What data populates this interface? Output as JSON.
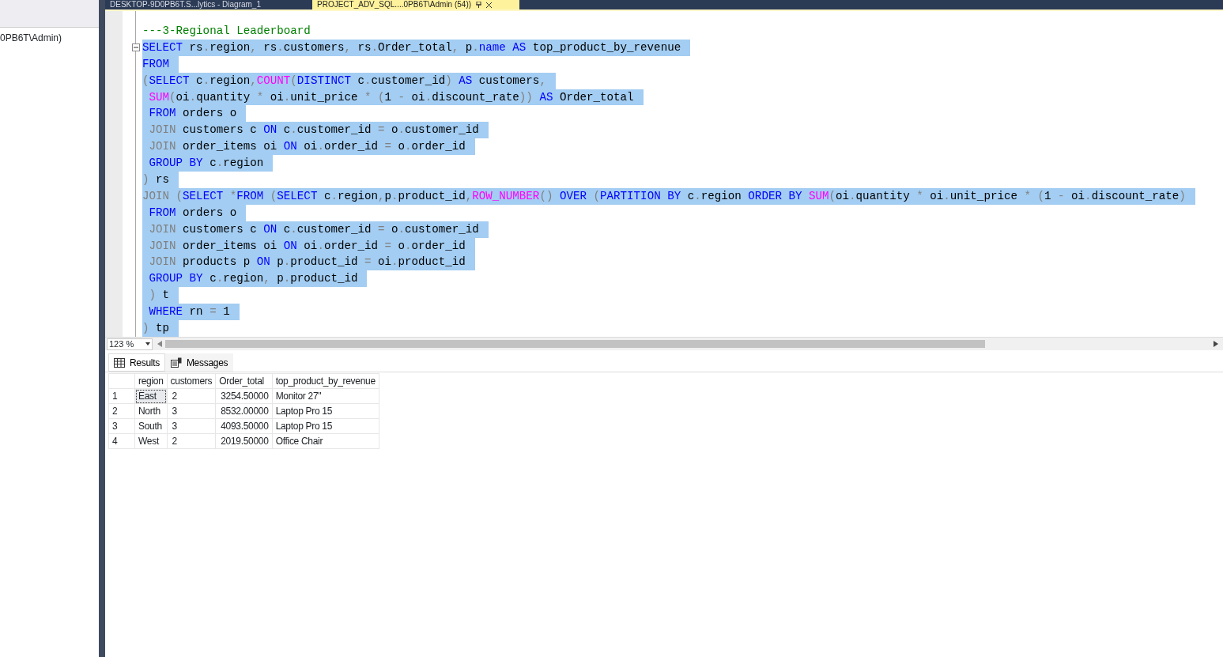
{
  "explorer": {
    "connection_text": "0PB6T\\Admin)"
  },
  "document_tabs": [
    {
      "label": "DESKTOP-9D0PB6T.S...lytics - Diagram_1",
      "selected": false
    },
    {
      "label": "PROJECT_ADV_SQL....0PB6T\\Admin (54))",
      "selected": true
    }
  ],
  "editor": {
    "lines": [
      {
        "selected": false,
        "fold": false,
        "tokens": [
          {
            "kind": "comment",
            "text": "---3-Regional Leaderboard"
          }
        ]
      },
      {
        "selected": true,
        "fold": true,
        "tokens": [
          {
            "kind": "keyword",
            "text": "SELECT"
          },
          {
            "kind": "plain",
            "text": " rs"
          },
          {
            "kind": "operator",
            "text": "."
          },
          {
            "kind": "plain",
            "text": "region"
          },
          {
            "kind": "operator",
            "text": ","
          },
          {
            "kind": "plain",
            "text": " rs"
          },
          {
            "kind": "operator",
            "text": "."
          },
          {
            "kind": "plain",
            "text": "customers"
          },
          {
            "kind": "operator",
            "text": ","
          },
          {
            "kind": "plain",
            "text": " rs"
          },
          {
            "kind": "operator",
            "text": "."
          },
          {
            "kind": "plain",
            "text": "Order_total"
          },
          {
            "kind": "operator",
            "text": ","
          },
          {
            "kind": "plain",
            "text": " p"
          },
          {
            "kind": "operator",
            "text": "."
          },
          {
            "kind": "keyword",
            "text": "name AS"
          },
          {
            "kind": "plain",
            "text": " top_product_by_revenue"
          }
        ]
      },
      {
        "selected": true,
        "fold": false,
        "tokens": [
          {
            "kind": "keyword",
            "text": "FROM"
          }
        ]
      },
      {
        "selected": true,
        "fold": false,
        "tokens": [
          {
            "kind": "operator",
            "text": "("
          },
          {
            "kind": "keyword",
            "text": "SELECT"
          },
          {
            "kind": "plain",
            "text": " c"
          },
          {
            "kind": "operator",
            "text": "."
          },
          {
            "kind": "plain",
            "text": "region"
          },
          {
            "kind": "operator",
            "text": ","
          },
          {
            "kind": "function",
            "text": "COUNT"
          },
          {
            "kind": "operator",
            "text": "("
          },
          {
            "kind": "keyword",
            "text": "DISTINCT"
          },
          {
            "kind": "plain",
            "text": " c"
          },
          {
            "kind": "operator",
            "text": "."
          },
          {
            "kind": "plain",
            "text": "customer_id"
          },
          {
            "kind": "operator",
            "text": ") "
          },
          {
            "kind": "keyword",
            "text": "AS"
          },
          {
            "kind": "plain",
            "text": " customers"
          },
          {
            "kind": "operator",
            "text": ","
          }
        ]
      },
      {
        "selected": true,
        "fold": false,
        "tokens": [
          {
            "kind": "function",
            "text": " SUM"
          },
          {
            "kind": "operator",
            "text": "("
          },
          {
            "kind": "plain",
            "text": "oi"
          },
          {
            "kind": "operator",
            "text": "."
          },
          {
            "kind": "plain",
            "text": "quantity "
          },
          {
            "kind": "operator",
            "text": "*"
          },
          {
            "kind": "plain",
            "text": " oi"
          },
          {
            "kind": "operator",
            "text": "."
          },
          {
            "kind": "plain",
            "text": "unit_price "
          },
          {
            "kind": "operator",
            "text": "* ("
          },
          {
            "kind": "plain",
            "text": "1 "
          },
          {
            "kind": "operator",
            "text": "-"
          },
          {
            "kind": "plain",
            "text": " oi"
          },
          {
            "kind": "operator",
            "text": "."
          },
          {
            "kind": "plain",
            "text": "discount_rate"
          },
          {
            "kind": "operator",
            "text": ")) "
          },
          {
            "kind": "keyword",
            "text": "AS"
          },
          {
            "kind": "plain",
            "text": " Order_total"
          }
        ]
      },
      {
        "selected": true,
        "fold": false,
        "tokens": [
          {
            "kind": "keyword",
            "text": " FROM"
          },
          {
            "kind": "plain",
            "text": " orders o"
          }
        ]
      },
      {
        "selected": true,
        "fold": false,
        "tokens": [
          {
            "kind": "operator",
            "text": " JOIN"
          },
          {
            "kind": "plain",
            "text": " customers c "
          },
          {
            "kind": "keyword",
            "text": "ON"
          },
          {
            "kind": "plain",
            "text": " c"
          },
          {
            "kind": "operator",
            "text": "."
          },
          {
            "kind": "plain",
            "text": "customer_id "
          },
          {
            "kind": "operator",
            "text": "="
          },
          {
            "kind": "plain",
            "text": " o"
          },
          {
            "kind": "operator",
            "text": "."
          },
          {
            "kind": "plain",
            "text": "customer_id"
          }
        ]
      },
      {
        "selected": true,
        "fold": false,
        "tokens": [
          {
            "kind": "operator",
            "text": " JOIN"
          },
          {
            "kind": "plain",
            "text": " order_items oi "
          },
          {
            "kind": "keyword",
            "text": "ON"
          },
          {
            "kind": "plain",
            "text": " oi"
          },
          {
            "kind": "operator",
            "text": "."
          },
          {
            "kind": "plain",
            "text": "order_id "
          },
          {
            "kind": "operator",
            "text": "="
          },
          {
            "kind": "plain",
            "text": " o"
          },
          {
            "kind": "operator",
            "text": "."
          },
          {
            "kind": "plain",
            "text": "order_id"
          }
        ]
      },
      {
        "selected": true,
        "fold": false,
        "tokens": [
          {
            "kind": "keyword",
            "text": " GROUP BY"
          },
          {
            "kind": "plain",
            "text": " c"
          },
          {
            "kind": "operator",
            "text": "."
          },
          {
            "kind": "plain",
            "text": "region"
          }
        ]
      },
      {
        "selected": true,
        "fold": false,
        "tokens": [
          {
            "kind": "operator",
            "text": ")"
          },
          {
            "kind": "plain",
            "text": " rs"
          }
        ]
      },
      {
        "selected": true,
        "fold": false,
        "tokens": [
          {
            "kind": "operator",
            "text": "JOIN ("
          },
          {
            "kind": "keyword",
            "text": "SELECT"
          },
          {
            "kind": "operator",
            "text": " *"
          },
          {
            "kind": "keyword",
            "text": "FROM"
          },
          {
            "kind": "operator",
            "text": " ("
          },
          {
            "kind": "keyword",
            "text": "SELECT"
          },
          {
            "kind": "plain",
            "text": " c"
          },
          {
            "kind": "operator",
            "text": "."
          },
          {
            "kind": "plain",
            "text": "region"
          },
          {
            "kind": "operator",
            "text": ","
          },
          {
            "kind": "plain",
            "text": "p"
          },
          {
            "kind": "operator",
            "text": "."
          },
          {
            "kind": "plain",
            "text": "product_id"
          },
          {
            "kind": "operator",
            "text": ","
          },
          {
            "kind": "function",
            "text": "ROW_NUMBER"
          },
          {
            "kind": "operator",
            "text": "() "
          },
          {
            "kind": "keyword",
            "text": "OVER"
          },
          {
            "kind": "operator",
            "text": " ("
          },
          {
            "kind": "keyword",
            "text": "PARTITION BY"
          },
          {
            "kind": "plain",
            "text": " c"
          },
          {
            "kind": "operator",
            "text": "."
          },
          {
            "kind": "plain",
            "text": "region "
          },
          {
            "kind": "keyword",
            "text": "ORDER BY"
          },
          {
            "kind": "function",
            "text": " SUM"
          },
          {
            "kind": "operator",
            "text": "("
          },
          {
            "kind": "plain",
            "text": "oi"
          },
          {
            "kind": "operator",
            "text": "."
          },
          {
            "kind": "plain",
            "text": "quantity "
          },
          {
            "kind": "operator",
            "text": "*"
          },
          {
            "kind": "plain",
            "text": " oi"
          },
          {
            "kind": "operator",
            "text": "."
          },
          {
            "kind": "plain",
            "text": "unit_price "
          },
          {
            "kind": "operator",
            "text": "* ("
          },
          {
            "kind": "plain",
            "text": "1 "
          },
          {
            "kind": "operator",
            "text": "-"
          },
          {
            "kind": "plain",
            "text": " oi"
          },
          {
            "kind": "operator",
            "text": "."
          },
          {
            "kind": "plain",
            "text": "discount_rate"
          },
          {
            "kind": "operator",
            "text": ")"
          }
        ]
      },
      {
        "selected": true,
        "fold": false,
        "tokens": [
          {
            "kind": "keyword",
            "text": " FROM"
          },
          {
            "kind": "plain",
            "text": " orders o"
          }
        ]
      },
      {
        "selected": true,
        "fold": false,
        "tokens": [
          {
            "kind": "operator",
            "text": " JOIN"
          },
          {
            "kind": "plain",
            "text": " customers c "
          },
          {
            "kind": "keyword",
            "text": "ON"
          },
          {
            "kind": "plain",
            "text": " c"
          },
          {
            "kind": "operator",
            "text": "."
          },
          {
            "kind": "plain",
            "text": "customer_id "
          },
          {
            "kind": "operator",
            "text": "="
          },
          {
            "kind": "plain",
            "text": " o"
          },
          {
            "kind": "operator",
            "text": "."
          },
          {
            "kind": "plain",
            "text": "customer_id"
          }
        ]
      },
      {
        "selected": true,
        "fold": false,
        "tokens": [
          {
            "kind": "operator",
            "text": " JOIN"
          },
          {
            "kind": "plain",
            "text": " order_items oi "
          },
          {
            "kind": "keyword",
            "text": "ON"
          },
          {
            "kind": "plain",
            "text": " oi"
          },
          {
            "kind": "operator",
            "text": "."
          },
          {
            "kind": "plain",
            "text": "order_id "
          },
          {
            "kind": "operator",
            "text": "="
          },
          {
            "kind": "plain",
            "text": " o"
          },
          {
            "kind": "operator",
            "text": "."
          },
          {
            "kind": "plain",
            "text": "order_id"
          }
        ]
      },
      {
        "selected": true,
        "fold": false,
        "tokens": [
          {
            "kind": "operator",
            "text": " JOIN"
          },
          {
            "kind": "plain",
            "text": " products p "
          },
          {
            "kind": "keyword",
            "text": "ON"
          },
          {
            "kind": "plain",
            "text": " p"
          },
          {
            "kind": "operator",
            "text": "."
          },
          {
            "kind": "plain",
            "text": "product_id "
          },
          {
            "kind": "operator",
            "text": "="
          },
          {
            "kind": "plain",
            "text": " oi"
          },
          {
            "kind": "operator",
            "text": "."
          },
          {
            "kind": "plain",
            "text": "product_id"
          }
        ]
      },
      {
        "selected": true,
        "fold": false,
        "tokens": [
          {
            "kind": "keyword",
            "text": " GROUP BY"
          },
          {
            "kind": "plain",
            "text": " c"
          },
          {
            "kind": "operator",
            "text": "."
          },
          {
            "kind": "plain",
            "text": "region"
          },
          {
            "kind": "operator",
            "text": ","
          },
          {
            "kind": "plain",
            "text": " p"
          },
          {
            "kind": "operator",
            "text": "."
          },
          {
            "kind": "plain",
            "text": "product_id"
          }
        ]
      },
      {
        "selected": true,
        "fold": false,
        "tokens": [
          {
            "kind": "operator",
            "text": " )"
          },
          {
            "kind": "plain",
            "text": " t"
          }
        ]
      },
      {
        "selected": true,
        "fold": false,
        "tokens": [
          {
            "kind": "keyword",
            "text": " WHERE"
          },
          {
            "kind": "plain",
            "text": " rn "
          },
          {
            "kind": "operator",
            "text": "="
          },
          {
            "kind": "plain",
            "text": " 1"
          }
        ]
      },
      {
        "selected": true,
        "fold": false,
        "tokens": [
          {
            "kind": "operator",
            "text": ")"
          },
          {
            "kind": "plain",
            "text": " tp"
          }
        ]
      }
    ]
  },
  "zoom": {
    "value": "123 %"
  },
  "result_tabs": [
    {
      "label": "Results",
      "selected": true
    },
    {
      "label": "Messages",
      "selected": false
    }
  ],
  "table": {
    "columns": [
      "region",
      "customers",
      "Order_total",
      "top_product_by_revenue"
    ],
    "rows": [
      {
        "number": "1",
        "cells": [
          {
            "text": "East",
            "focused": true
          },
          {
            "text": "2",
            "focused": false
          },
          {
            "text": "3254.50000",
            "focused": false
          },
          {
            "text": "Monitor 27\"",
            "focused": false
          }
        ]
      },
      {
        "number": "2",
        "cells": [
          {
            "text": "North",
            "focused": false
          },
          {
            "text": "3",
            "focused": false
          },
          {
            "text": "8532.00000",
            "focused": false
          },
          {
            "text": "Laptop Pro 15",
            "focused": false
          }
        ]
      },
      {
        "number": "3",
        "cells": [
          {
            "text": "South",
            "focused": false
          },
          {
            "text": "3",
            "focused": false
          },
          {
            "text": "4093.50000",
            "focused": false
          },
          {
            "text": "Laptop Pro 15",
            "focused": false
          }
        ]
      },
      {
        "number": "4",
        "cells": [
          {
            "text": "West",
            "focused": false
          },
          {
            "text": "2",
            "focused": false
          },
          {
            "text": "2019.50000",
            "focused": false
          },
          {
            "text": "Office Chair",
            "focused": false
          }
        ]
      }
    ]
  }
}
